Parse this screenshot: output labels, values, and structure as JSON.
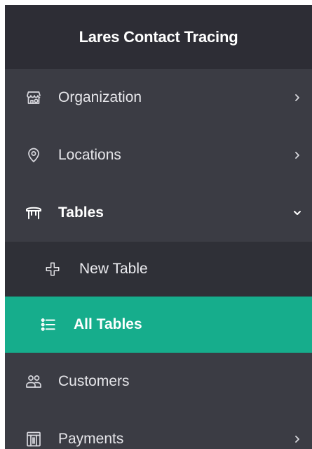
{
  "brand": {
    "title": "Lares Contact Tracing"
  },
  "menu": {
    "organization": {
      "label": "Organization",
      "icon": "store-icon"
    },
    "locations": {
      "label": "Locations",
      "icon": "location-pin-icon"
    },
    "tables": {
      "label": "Tables",
      "icon": "table-icon",
      "expanded": true,
      "children": {
        "new_table": {
          "label": "New Table",
          "icon": "plus-icon"
        },
        "all_tables": {
          "label": "All Tables",
          "icon": "list-icon",
          "selected": true
        }
      }
    },
    "customers": {
      "label": "Customers",
      "icon": "users-icon"
    },
    "payments": {
      "label": "Payments",
      "icon": "receipt-icon"
    }
  },
  "colors": {
    "sidebar_bg": "#3b3c44",
    "brand_bg": "#2d2d35",
    "submenu_bg": "#2f3037",
    "accent": "#16ad8c"
  }
}
